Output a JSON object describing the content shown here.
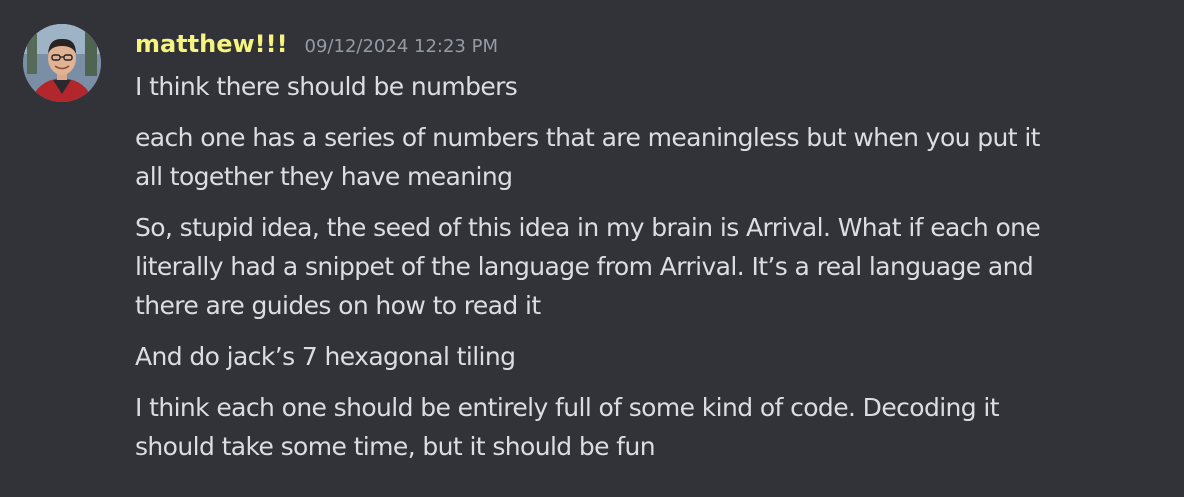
{
  "message": {
    "author": "matthew!!!",
    "timestamp": "09/12/2024 12:23 PM",
    "author_color": "#f6f47e",
    "avatar_icon": "user-avatar",
    "paragraphs": [
      {
        "lines": [
          "I think there should be numbers"
        ]
      },
      {
        "lines": [
          "each one has a series of numbers that are meaningless but when you put it",
          "all together they have meaning"
        ]
      },
      {
        "lines": [
          "So, stupid idea, the seed of this idea in my brain is Arrival. What if each one",
          "literally had a snippet of the language from Arrival. It’s a real language and",
          "there are guides on how to read it"
        ]
      },
      {
        "lines": [
          "And do jack’s 7 hexagonal tiling"
        ]
      },
      {
        "lines": [
          "I think each one should be entirely full of some kind of code. Decoding it",
          "should take some time, but it should be fun"
        ]
      }
    ]
  },
  "theme": {
    "background": "#313338",
    "text": "#dbdee1",
    "muted": "#949ba4"
  }
}
